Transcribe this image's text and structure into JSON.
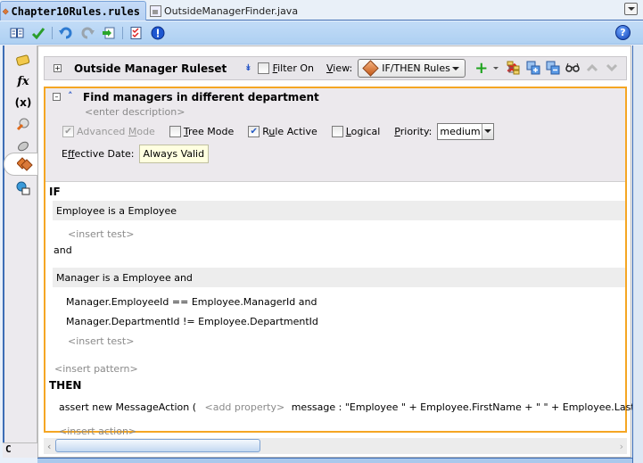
{
  "tabs": [
    {
      "label": "Chapter10Rules.rules",
      "active": true,
      "icon": "rules-diamond-icon"
    },
    {
      "label": "OutsideManagerFinder.java",
      "active": false,
      "icon": "java-file-icon"
    }
  ],
  "toolbar": {
    "icons": [
      "dictionary-book-icon",
      "validate-check-icon",
      "undo-icon",
      "redo-icon",
      "export-icon",
      "checklist-icon",
      "info-icon"
    ],
    "help_glyph": "?"
  },
  "palette": {
    "items": [
      "facts-icon",
      "functions-icon",
      "variables-icon",
      "links-icon",
      "decision-functions-icon",
      "rule-functions-icon",
      "translations-icon",
      "rulesets-icon"
    ],
    "fx_glyph": "fx",
    "vars_glyph": "(x)",
    "bottom_label": "C"
  },
  "ruleset": {
    "title": "Outside Manager Ruleset",
    "filter_label_first": "F",
    "filter_label_rest": "ilter On",
    "filter_checked": false,
    "view_label_first": "V",
    "view_label_rest": "iew:",
    "view_value": "IF/THEN Rules"
  },
  "rule": {
    "title": "Find managers in different department",
    "description_placeholder": "<enter description>",
    "options": {
      "advanced_mode": {
        "pre": "Advanced ",
        "u": "M",
        "post": "ode",
        "checked": true,
        "disabled": true
      },
      "tree_mode": {
        "pre": "",
        "u": "T",
        "post": "ree Mode",
        "checked": false
      },
      "rule_active": {
        "pre": "R",
        "u": "u",
        "post": "le Active",
        "checked": true
      },
      "logical": {
        "pre": "",
        "u": "L",
        "post": "ogical",
        "checked": false
      }
    },
    "priority_label_first": "P",
    "priority_label_rest": "riority:",
    "priority_value": "medium",
    "effective_date_pre": "E",
    "effective_date_u": "f",
    "effective_date_post": "fective Date:",
    "effective_date_value": "Always Valid"
  },
  "body": {
    "if_label": "IF",
    "pattern1": "Employee is a Employee",
    "insert_test_1": "<insert test>",
    "and_label": "and",
    "pattern2": "Manager is a Employee  and",
    "test1": "Manager.EmployeeId  ==  Employee.ManagerId and",
    "test2": "Manager.DepartmentId  !=  Employee.DepartmentId",
    "insert_test_2": "<insert test>",
    "insert_pattern": "<insert pattern>",
    "then_label": "THEN",
    "action_pre": "assert new MessageAction (",
    "action_add_property": "<add property>",
    "action_post": "message : \"Employee \" +  Employee.FirstName + \" \" + Employee.LastName + \"(\" + Er",
    "insert_action": "<insert action>"
  },
  "colors": {
    "rule_border": "#f5a623",
    "toolbar_bg": "#b6d4f4",
    "accent_blue": "#2352c4"
  }
}
